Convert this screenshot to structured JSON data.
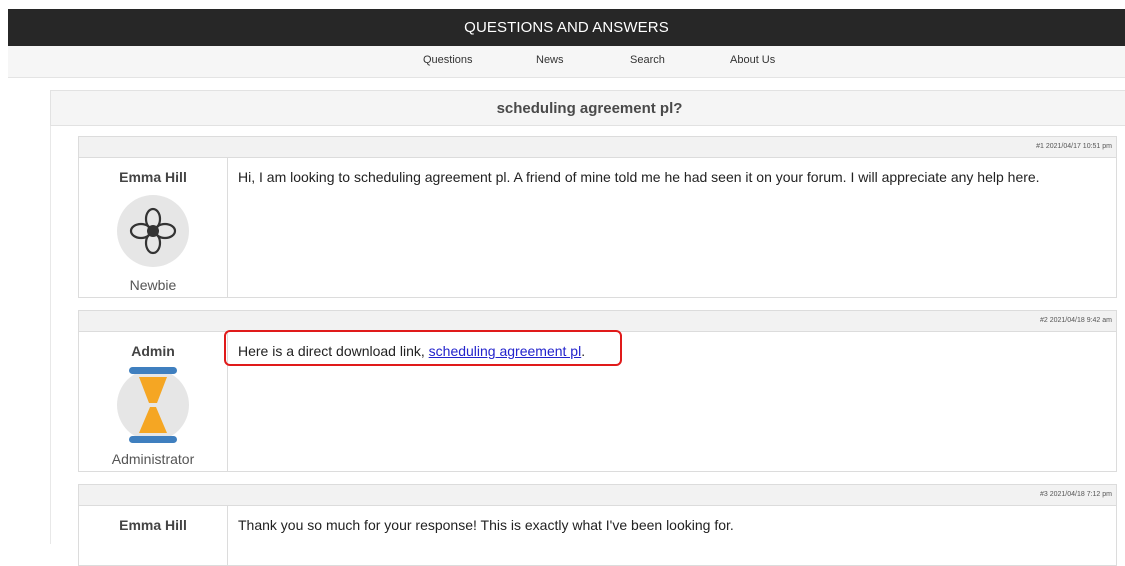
{
  "header": {
    "title": "QUESTIONS AND ANSWERS"
  },
  "nav": {
    "items": [
      {
        "label": "Questions"
      },
      {
        "label": "News"
      },
      {
        "label": "Search"
      },
      {
        "label": "About Us"
      }
    ]
  },
  "thread": {
    "title": "scheduling agreement pl?"
  },
  "posts": [
    {
      "meta": "#1 2021/04/17 10:51 pm",
      "author": "Emma Hill",
      "role": "Newbie",
      "avatar_icon": "flower-icon",
      "text": "Hi, I am looking to scheduling agreement pl. A friend of mine told me he had seen it on your forum. I will appreciate any help here."
    },
    {
      "meta": "#2 2021/04/18 9:42 am",
      "author": "Admin",
      "role": "Administrator",
      "avatar_icon": "hourglass-icon",
      "text_prefix": "Here is a direct download link, ",
      "link_text": "scheduling agreement pl",
      "text_suffix": "."
    },
    {
      "meta": "#3 2021/04/18 7:12 pm",
      "author": "Emma Hill",
      "text": "Thank you so much for your response! This is exactly what I've been looking for."
    }
  ],
  "colors": {
    "header_bg": "#272727",
    "link": "#2222cc",
    "highlight": "#e01a1a",
    "hourglass_sand": "#f5a623",
    "hourglass_frame": "#3f7fbf"
  }
}
